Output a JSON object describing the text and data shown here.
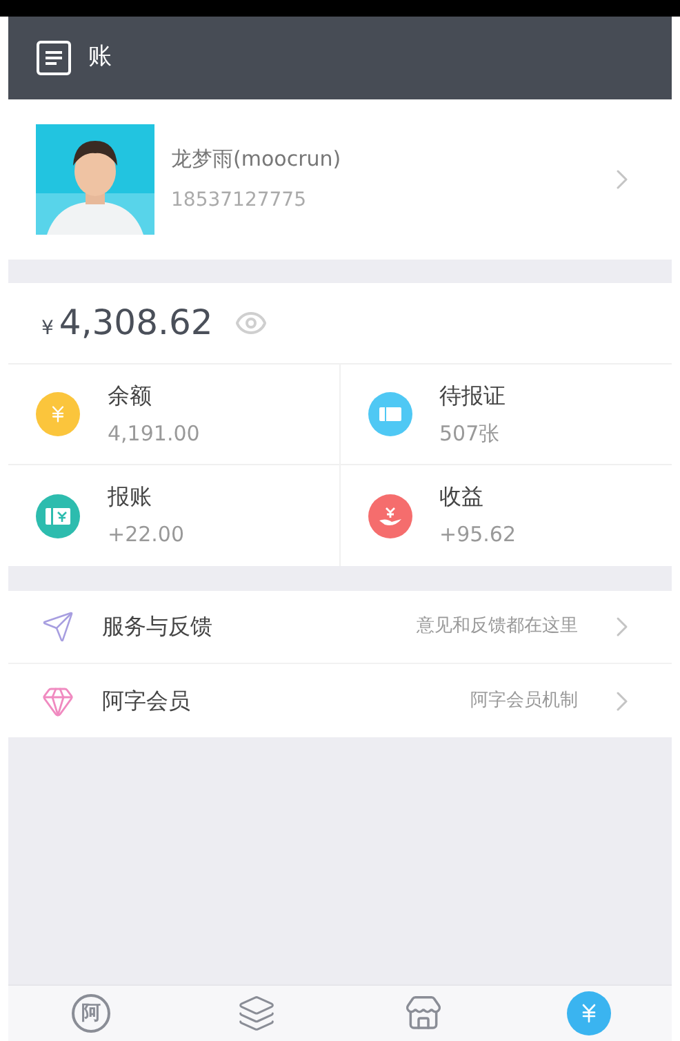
{
  "header": {
    "title": "账"
  },
  "profile": {
    "name": "龙梦雨(moocrun)",
    "phone": "18537127775"
  },
  "balance": {
    "currency": "¥",
    "amount": "4,308.62"
  },
  "stats": [
    {
      "kind": "balance",
      "label": "余额",
      "value": "4,191.00",
      "color": "#fbc53c"
    },
    {
      "kind": "ticket",
      "label": "待报证",
      "value": "507张",
      "color": "#4fc8f4"
    },
    {
      "kind": "reimburse",
      "label": "报账",
      "value": "+22.00",
      "color": "#2dbcae"
    },
    {
      "kind": "income",
      "label": "收益",
      "value": "+95.62",
      "color": "#f56d6d"
    }
  ],
  "menu": [
    {
      "kind": "feedback",
      "label": "服务与反馈",
      "hint": "意见和反馈都在这里"
    },
    {
      "kind": "member",
      "label": "阿字会员",
      "hint": "阿字会员机制"
    }
  ],
  "tabs": [
    {
      "kind": "logo",
      "glyph": "阿",
      "selected": false
    },
    {
      "kind": "layers",
      "selected": false
    },
    {
      "kind": "store",
      "selected": false
    },
    {
      "kind": "yen",
      "selected": true
    }
  ]
}
